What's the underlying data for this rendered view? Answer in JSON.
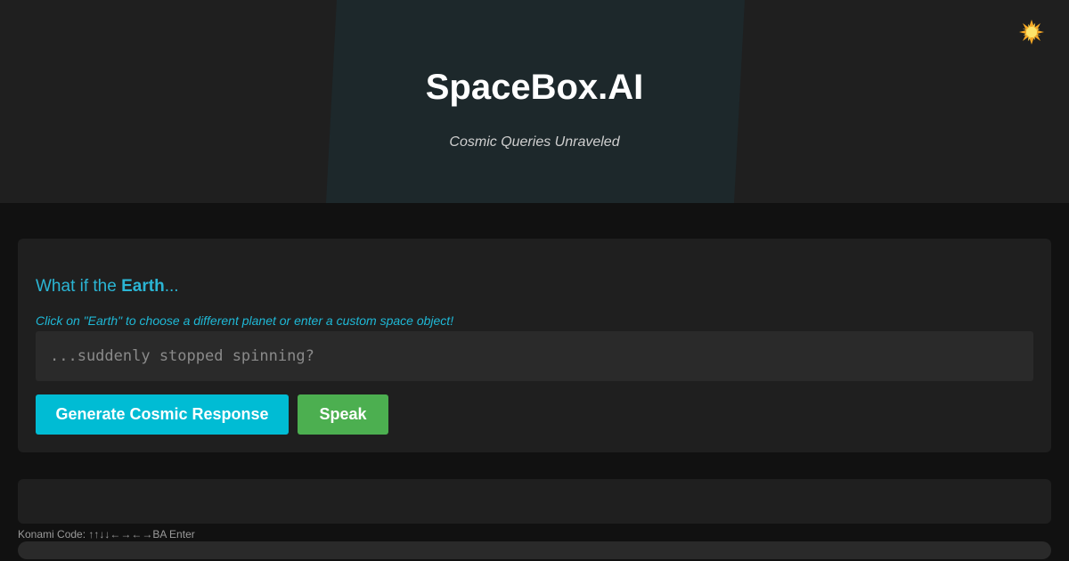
{
  "header": {
    "title": "SpaceBox.AI",
    "tagline": "Cosmic Queries Unraveled",
    "theme_icon": "sun-icon"
  },
  "query_card": {
    "question_prefix": "What if the ",
    "planet": "Earth",
    "question_suffix": "...",
    "hint": "Click on \"Earth\" to choose a different planet or enter a custom space object!",
    "input_value": "",
    "input_placeholder": "...suddenly stopped spinning?",
    "generate_label": "Generate Cosmic Response",
    "speak_label": "Speak"
  },
  "footer": {
    "konami": "Konami Code: ↑↑↓↓←→←→BA Enter"
  },
  "colors": {
    "accent": "#00bcd4",
    "speak": "#4caf50",
    "background": "#111111",
    "card": "#1f1f1f"
  }
}
